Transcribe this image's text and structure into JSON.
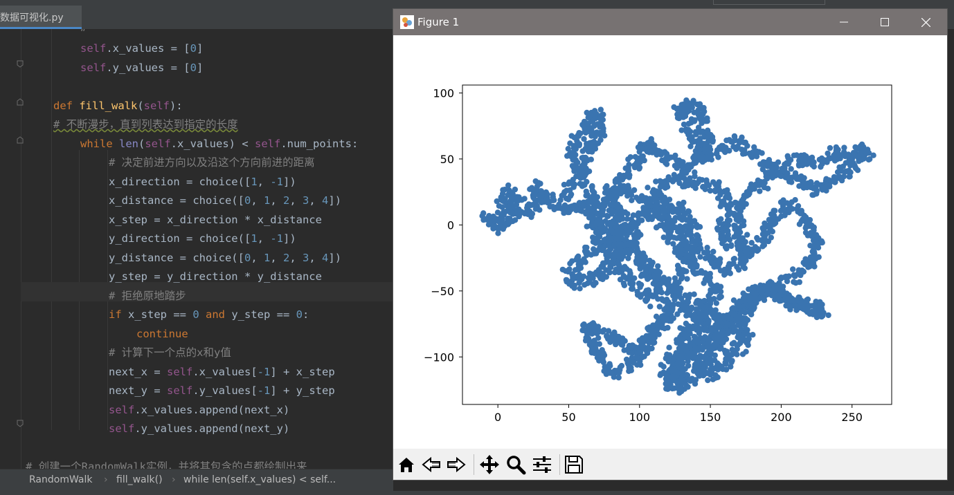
{
  "ide": {
    "tab_label": "数据可视化.py",
    "code": [
      {
        "t": 70,
        "indent": 116,
        "parts": [
          [
            "self",
            "self"
          ],
          [
            "",
            ".x_values = ["
          ],
          [
            "num",
            "0"
          ],
          [
            "",
            "]"
          ]
        ]
      },
      {
        "t": 98,
        "indent": 116,
        "parts": [
          [
            "self",
            "self"
          ],
          [
            "",
            ".y_values = ["
          ],
          [
            "num",
            "0"
          ],
          [
            "",
            "]"
          ]
        ]
      },
      {
        "t": 153,
        "indent": 77,
        "parts": [
          [
            "kw",
            "def "
          ],
          [
            "fn",
            "fill_walk"
          ],
          [
            "",
            "("
          ],
          [
            "self",
            "self"
          ],
          [
            "",
            "):"
          ]
        ]
      },
      {
        "t": 180,
        "indent": 77,
        "parts": [
          [
            "cm-u",
            "# 不断漫步，直到列表达到指定的长度"
          ]
        ]
      },
      {
        "t": 208,
        "indent": 116,
        "parts": [
          [
            "kw",
            "while "
          ],
          [
            "bi",
            "len"
          ],
          [
            "",
            "("
          ],
          [
            "self",
            "self"
          ],
          [
            "",
            ".x_values) < "
          ],
          [
            "self",
            "self"
          ],
          [
            "",
            ".num_points:"
          ]
        ]
      },
      {
        "t": 235,
        "indent": 157,
        "parts": [
          [
            "cm",
            "# 决定前进方向以及沿这个方向前进的距离"
          ]
        ]
      },
      {
        "t": 263,
        "indent": 157,
        "parts": [
          [
            "",
            "x_direction = choice(["
          ],
          [
            "num",
            "1"
          ],
          [
            "",
            ", "
          ],
          [
            "num",
            "-1"
          ],
          [
            "",
            "])"
          ]
        ]
      },
      {
        "t": 290,
        "indent": 157,
        "parts": [
          [
            "",
            "x_distance = choice(["
          ],
          [
            "num",
            "0"
          ],
          [
            "",
            ", "
          ],
          [
            "num",
            "1"
          ],
          [
            "",
            ", "
          ],
          [
            "num",
            "2"
          ],
          [
            "",
            ", "
          ],
          [
            "num",
            "3"
          ],
          [
            "",
            ", "
          ],
          [
            "num",
            "4"
          ],
          [
            "",
            "])"
          ]
        ]
      },
      {
        "t": 318,
        "indent": 157,
        "parts": [
          [
            "",
            "x_step = x_direction * x_distance"
          ]
        ]
      },
      {
        "t": 345,
        "indent": 157,
        "parts": [
          [
            "",
            "y_direction = choice(["
          ],
          [
            "num",
            "1"
          ],
          [
            "",
            ", "
          ],
          [
            "num",
            "-1"
          ],
          [
            "",
            "])"
          ]
        ]
      },
      {
        "t": 373,
        "indent": 157,
        "parts": [
          [
            "",
            "y_distance = choice(["
          ],
          [
            "num",
            "0"
          ],
          [
            "",
            ", "
          ],
          [
            "num",
            "1"
          ],
          [
            "",
            ", "
          ],
          [
            "num",
            "2"
          ],
          [
            "",
            ", "
          ],
          [
            "num",
            "3"
          ],
          [
            "",
            ", "
          ],
          [
            "num",
            "4"
          ],
          [
            "",
            "])"
          ]
        ]
      },
      {
        "t": 400,
        "indent": 157,
        "parts": [
          [
            "",
            "y_step = y_direction * y_distance"
          ]
        ]
      },
      {
        "t": 428,
        "indent": 157,
        "parts": [
          [
            "cm",
            "# 拒绝原地踏步"
          ]
        ]
      },
      {
        "t": 455,
        "indent": 157,
        "parts": [
          [
            "kw",
            "if "
          ],
          [
            "",
            "x_step == "
          ],
          [
            "num",
            "0"
          ],
          [
            "kw",
            " and "
          ],
          [
            "",
            "y_step == "
          ],
          [
            "num",
            "0"
          ],
          [
            "",
            ":"
          ]
        ]
      },
      {
        "t": 483,
        "indent": 197,
        "parts": [
          [
            "kw",
            "continue"
          ]
        ]
      },
      {
        "t": 510,
        "indent": 157,
        "parts": [
          [
            "cm",
            "# 计算下一个点的x和y值"
          ]
        ]
      },
      {
        "t": 538,
        "indent": 157,
        "parts": [
          [
            "",
            "next_x = "
          ],
          [
            "self",
            "self"
          ],
          [
            "",
            ".x_values["
          ],
          [
            "num",
            "-1"
          ],
          [
            "",
            "] + x_step"
          ]
        ]
      },
      {
        "t": 565,
        "indent": 157,
        "parts": [
          [
            "",
            "next_y = "
          ],
          [
            "self",
            "self"
          ],
          [
            "",
            ".y_values["
          ],
          [
            "num",
            "-1"
          ],
          [
            "",
            "] + y_step"
          ]
        ]
      },
      {
        "t": 593,
        "indent": 157,
        "parts": [
          [
            "self",
            "self"
          ],
          [
            "",
            ".x_values.append(next_x)"
          ]
        ]
      },
      {
        "t": 620,
        "indent": 157,
        "parts": [
          [
            "self",
            "self"
          ],
          [
            "",
            ".y_values.append(next_y)"
          ]
        ]
      },
      {
        "t": 675,
        "indent": 37,
        "parts": [
          [
            "cm",
            "# 创建一个RandomWalk实例，并将其包含的点都绘制出来"
          ]
        ]
      }
    ],
    "breadcrumb": [
      "RandomWalk",
      "fill_walk()",
      "while len(self.x_values) < self..."
    ]
  },
  "figure": {
    "title": "Figure 1",
    "toolbar": [
      "home-icon",
      "back-icon",
      "forward-icon",
      "pan-icon",
      "zoom-icon",
      "configure-subplots-icon",
      "save-icon"
    ]
  },
  "chart_data": {
    "type": "scatter",
    "title": "",
    "xlabel": "",
    "ylabel": "",
    "xlim": [
      -25,
      278
    ],
    "ylim": [
      -136,
      106
    ],
    "xticks": [
      0,
      50,
      100,
      150,
      200,
      250
    ],
    "yticks": [
      100,
      50,
      0,
      -50,
      -100
    ],
    "color": "#3a74b0",
    "grid": false,
    "path": [
      [
        0,
        0
      ],
      [
        -8,
        5
      ],
      [
        5,
        -3
      ],
      [
        3,
        15
      ],
      [
        8,
        27
      ],
      [
        15,
        18
      ],
      [
        10,
        5
      ],
      [
        22,
        12
      ],
      [
        28,
        15
      ],
      [
        30,
        22
      ],
      [
        25,
        30
      ],
      [
        38,
        18
      ],
      [
        45,
        12
      ],
      [
        55,
        15
      ],
      [
        75,
        12
      ],
      [
        82,
        8
      ],
      [
        85,
        -5
      ],
      [
        72,
        -15
      ],
      [
        60,
        -25
      ],
      [
        50,
        -38
      ],
      [
        58,
        -45
      ],
      [
        68,
        -40
      ],
      [
        80,
        -30
      ],
      [
        88,
        -20
      ],
      [
        98,
        -10
      ],
      [
        90,
        5
      ],
      [
        80,
        20
      ],
      [
        85,
        28
      ],
      [
        95,
        24
      ],
      [
        102,
        18
      ],
      [
        112,
        8
      ],
      [
        118,
        -2
      ],
      [
        125,
        -12
      ],
      [
        132,
        -22
      ],
      [
        140,
        -30
      ],
      [
        148,
        -42
      ],
      [
        155,
        -50
      ],
      [
        150,
        -60
      ],
      [
        142,
        -70
      ],
      [
        134,
        -80
      ],
      [
        126,
        -92
      ],
      [
        120,
        -105
      ],
      [
        118,
        -118
      ],
      [
        125,
        -122
      ],
      [
        130,
        -108
      ],
      [
        135,
        -95
      ],
      [
        142,
        -88
      ],
      [
        148,
        -76
      ],
      [
        140,
        -66
      ],
      [
        128,
        -62
      ],
      [
        118,
        -70
      ],
      [
        110,
        -80
      ],
      [
        103,
        -92
      ],
      [
        95,
        -105
      ],
      [
        85,
        -112
      ],
      [
        75,
        -108
      ],
      [
        70,
        -96
      ],
      [
        65,
        -85
      ],
      [
        62,
        -75
      ],
      [
        70,
        -78
      ],
      [
        80,
        -86
      ],
      [
        92,
        -92
      ],
      [
        100,
        -98
      ],
      [
        108,
        -88
      ],
      [
        115,
        -76
      ],
      [
        118,
        -65
      ],
      [
        122,
        -52
      ],
      [
        128,
        -40
      ],
      [
        132,
        -30
      ],
      [
        136,
        -18
      ],
      [
        130,
        -5
      ],
      [
        122,
        5
      ],
      [
        115,
        15
      ],
      [
        110,
        25
      ],
      [
        118,
        32
      ],
      [
        128,
        35
      ],
      [
        138,
        32
      ],
      [
        148,
        30
      ],
      [
        158,
        28
      ],
      [
        162,
        18
      ],
      [
        160,
        8
      ],
      [
        158,
        -5
      ],
      [
        165,
        -15
      ],
      [
        175,
        -20
      ],
      [
        172,
        -8
      ],
      [
        168,
        5
      ],
      [
        170,
        15
      ],
      [
        178,
        25
      ],
      [
        185,
        30
      ],
      [
        190,
        38
      ],
      [
        198,
        42
      ],
      [
        205,
        48
      ],
      [
        212,
        50
      ],
      [
        222,
        45
      ],
      [
        232,
        48
      ],
      [
        240,
        55
      ],
      [
        248,
        52
      ],
      [
        255,
        58
      ],
      [
        262,
        56
      ],
      [
        252,
        45
      ],
      [
        242,
        38
      ],
      [
        235,
        32
      ],
      [
        228,
        25
      ],
      [
        220,
        30
      ],
      [
        210,
        35
      ],
      [
        200,
        40
      ],
      [
        190,
        45
      ],
      [
        182,
        52
      ],
      [
        175,
        60
      ],
      [
        168,
        64
      ],
      [
        160,
        58
      ],
      [
        152,
        55
      ],
      [
        145,
        50
      ],
      [
        140,
        60
      ],
      [
        136,
        70
      ],
      [
        132,
        80
      ],
      [
        128,
        88
      ],
      [
        135,
        92
      ],
      [
        142,
        84
      ],
      [
        145,
        72
      ],
      [
        148,
        62
      ],
      [
        142,
        50
      ],
      [
        135,
        42
      ],
      [
        128,
        45
      ],
      [
        120,
        50
      ],
      [
        112,
        55
      ],
      [
        105,
        62
      ],
      [
        100,
        55
      ],
      [
        95,
        45
      ],
      [
        90,
        38
      ],
      [
        85,
        30
      ],
      [
        78,
        22
      ],
      [
        72,
        15
      ],
      [
        65,
        5
      ],
      [
        70,
        -5
      ],
      [
        80,
        -12
      ],
      [
        92,
        -18
      ],
      [
        104,
        -28
      ],
      [
        112,
        -38
      ],
      [
        120,
        -48
      ],
      [
        132,
        -55
      ],
      [
        145,
        -62
      ],
      [
        156,
        -70
      ],
      [
        162,
        -78
      ],
      [
        158,
        -90
      ],
      [
        150,
        -100
      ],
      [
        142,
        -110
      ],
      [
        135,
        -118
      ],
      [
        128,
        -125
      ],
      [
        124,
        -112
      ],
      [
        130,
        -100
      ],
      [
        140,
        -92
      ],
      [
        152,
        -84
      ],
      [
        162,
        -72
      ],
      [
        170,
        -60
      ],
      [
        178,
        -52
      ],
      [
        186,
        -48
      ],
      [
        194,
        -52
      ],
      [
        202,
        -56
      ],
      [
        210,
        -58
      ],
      [
        218,
        -60
      ],
      [
        224,
        -62
      ],
      [
        230,
        -65
      ],
      [
        222,
        -68
      ],
      [
        212,
        -62
      ],
      [
        200,
        -55
      ],
      [
        192,
        -48
      ],
      [
        182,
        -55
      ],
      [
        172,
        -62
      ],
      [
        165,
        -72
      ],
      [
        170,
        -80
      ],
      [
        178,
        -86
      ],
      [
        172,
        -92
      ],
      [
        164,
        -100
      ],
      [
        158,
        -108
      ],
      [
        150,
        -114
      ],
      [
        142,
        -108
      ],
      [
        145,
        -98
      ],
      [
        152,
        -88
      ],
      [
        160,
        -82
      ],
      [
        168,
        -76
      ],
      [
        175,
        -68
      ],
      [
        182,
        -60
      ],
      [
        188,
        -50
      ],
      [
        196,
        -45
      ],
      [
        205,
        -42
      ],
      [
        212,
        -38
      ],
      [
        218,
        -30
      ],
      [
        222,
        -22
      ],
      [
        226,
        -12
      ],
      [
        220,
        -2
      ],
      [
        212,
        8
      ],
      [
        205,
        15
      ],
      [
        198,
        8
      ],
      [
        192,
        0
      ],
      [
        188,
        -10
      ],
      [
        182,
        -18
      ],
      [
        175,
        -25
      ],
      [
        168,
        -30
      ],
      [
        160,
        -35
      ],
      [
        152,
        -28
      ],
      [
        145,
        -20
      ],
      [
        140,
        -10
      ],
      [
        135,
        2
      ],
      [
        128,
        12
      ],
      [
        120,
        18
      ],
      [
        110,
        12
      ],
      [
        100,
        5
      ],
      [
        92,
        -2
      ],
      [
        85,
        -10
      ],
      [
        78,
        -18
      ],
      [
        82,
        -28
      ],
      [
        90,
        -38
      ],
      [
        98,
        -48
      ],
      [
        106,
        -58
      ],
      [
        112,
        -52
      ],
      [
        108,
        -40
      ],
      [
        102,
        -30
      ],
      [
        96,
        -22
      ],
      [
        88,
        -12
      ],
      [
        80,
        -2
      ],
      [
        72,
        8
      ],
      [
        66,
        20
      ],
      [
        62,
        32
      ],
      [
        58,
        42
      ],
      [
        55,
        50
      ],
      [
        52,
        58
      ],
      [
        58,
        65
      ],
      [
        62,
        72
      ],
      [
        65,
        80
      ],
      [
        68,
        86
      ],
      [
        72,
        78
      ],
      [
        70,
        68
      ],
      [
        66,
        60
      ],
      [
        62,
        50
      ],
      [
        58,
        42
      ],
      [
        54,
        35
      ],
      [
        50,
        28
      ],
      [
        46,
        22
      ]
    ]
  }
}
